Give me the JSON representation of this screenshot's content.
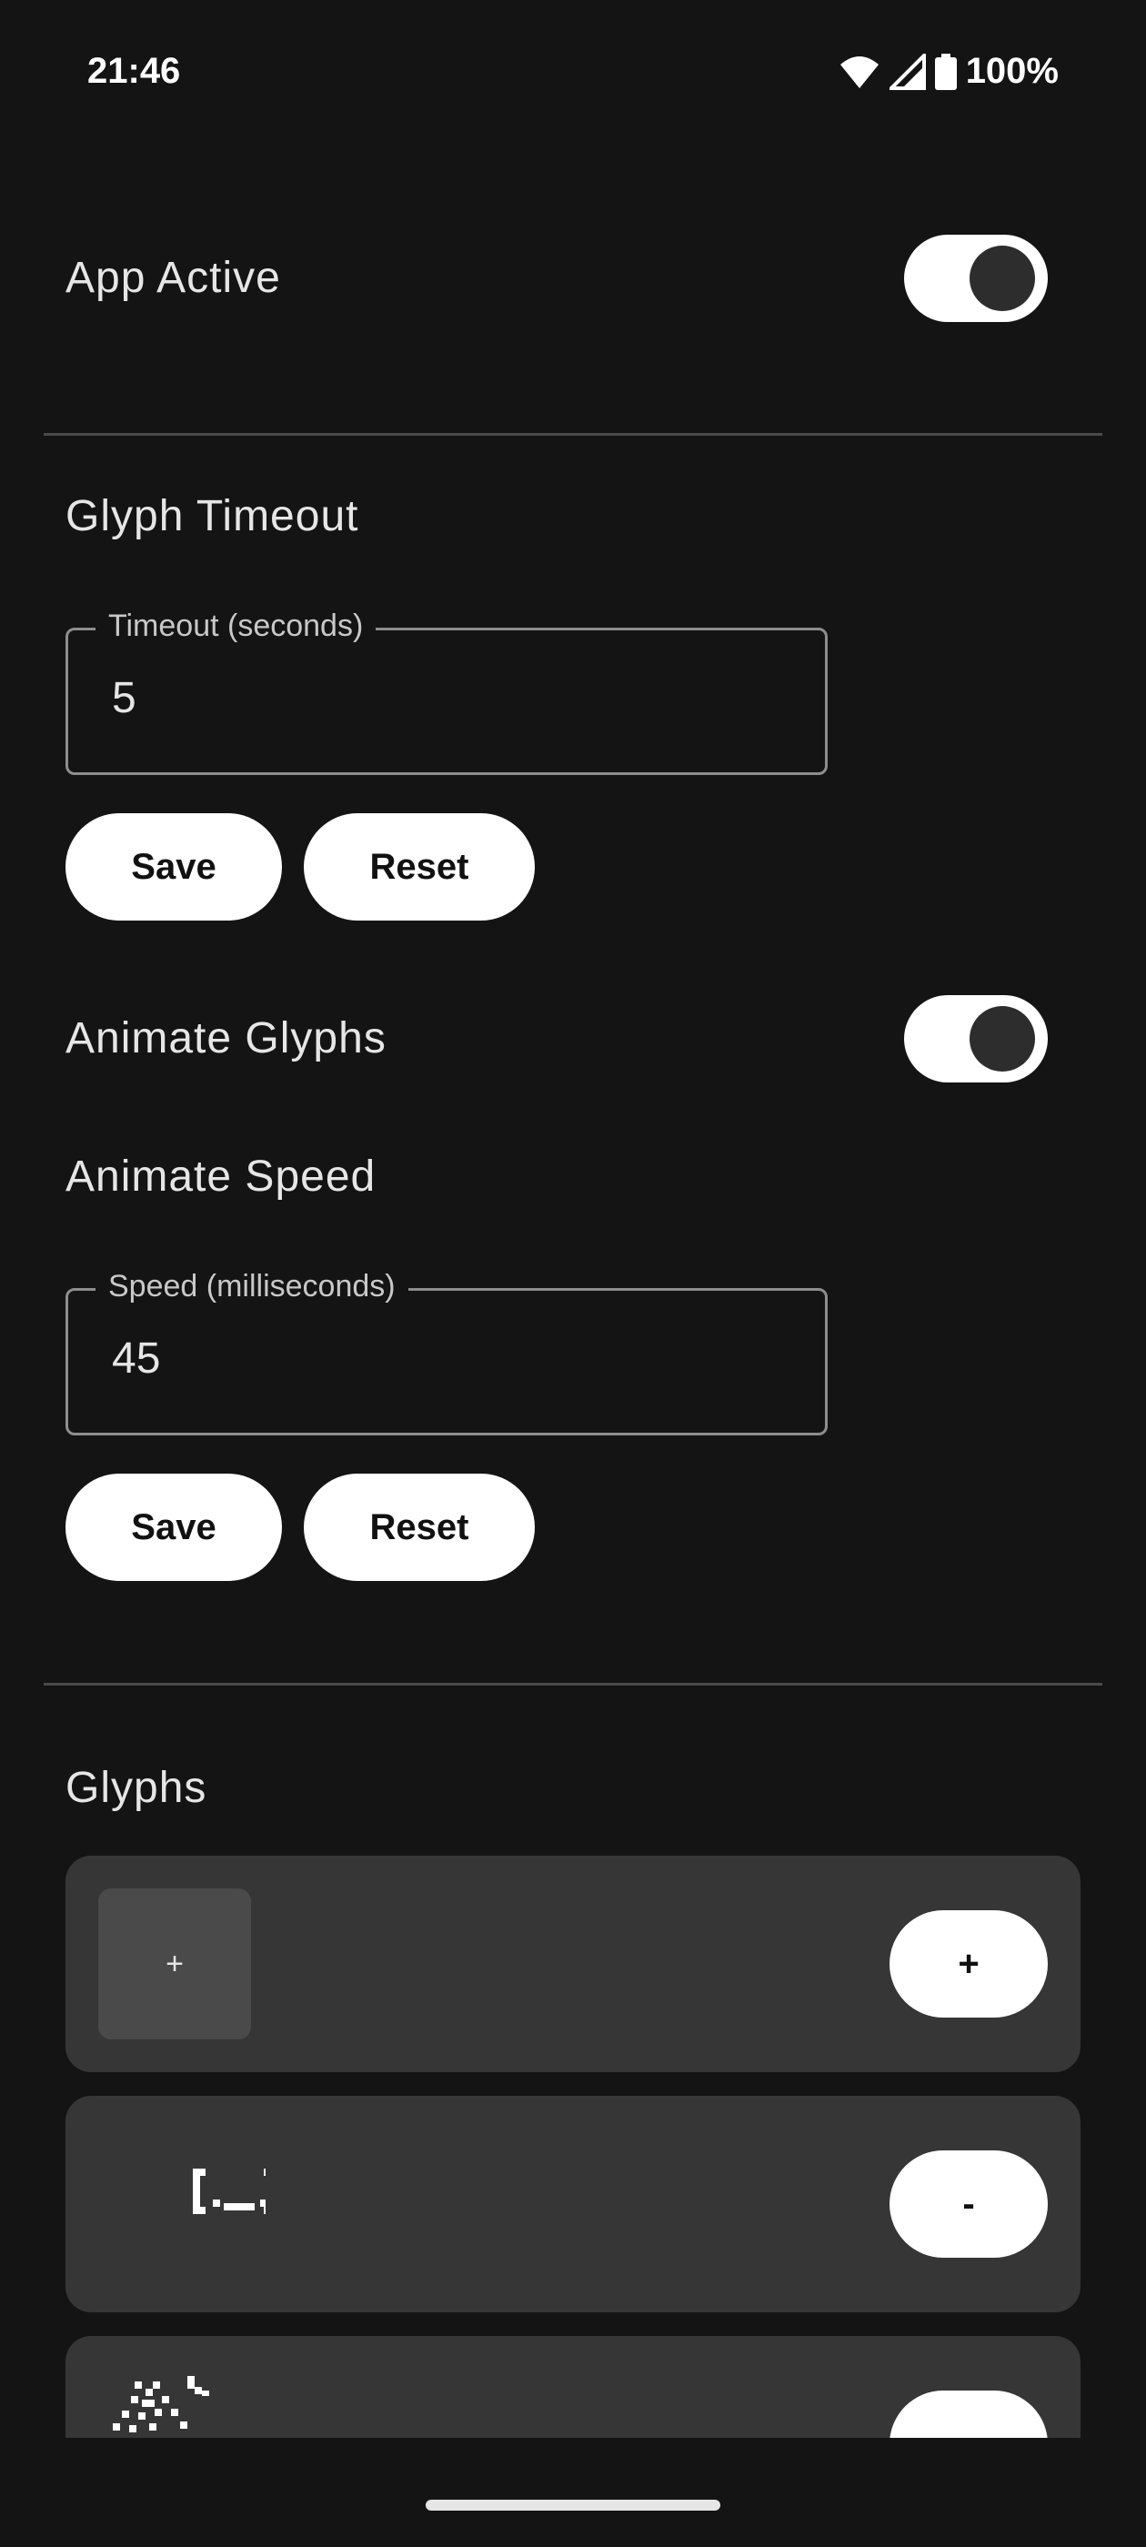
{
  "status_bar": {
    "time": "21:46",
    "battery": "100%",
    "icons": [
      "wifi-icon",
      "signal-icon",
      "battery-icon"
    ]
  },
  "app_active": {
    "label": "App Active",
    "enabled": true
  },
  "glyph_timeout": {
    "heading": "Glyph Timeout",
    "field_label": "Timeout (seconds)",
    "value": "5",
    "save_label": "Save",
    "reset_label": "Reset"
  },
  "animate_glyphs": {
    "label": "Animate Glyphs",
    "enabled": true
  },
  "animate_speed": {
    "heading": "Animate Speed",
    "field_label": "Speed (milliseconds)",
    "value": "45",
    "save_label": "Save",
    "reset_label": "Reset"
  },
  "glyphs": {
    "heading": "Glyphs",
    "add_card": {
      "thumb_label": "+",
      "button_label": "+"
    },
    "items": [
      {
        "art": "face-glyph",
        "button_label": "-"
      },
      {
        "art": "sparkle-glyph",
        "button_label": "-"
      }
    ]
  },
  "colors": {
    "background": "#141414",
    "card": "#363636",
    "accent": "#ffffff"
  }
}
